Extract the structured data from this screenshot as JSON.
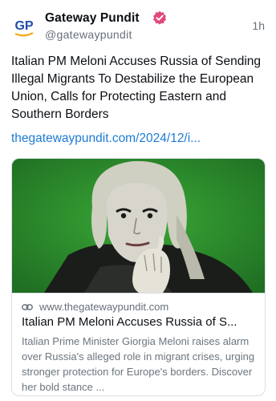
{
  "author": {
    "name": "Gateway Pundit",
    "handle": "@gatewaypundit",
    "avatar_text": "GP",
    "avatar_color": "#1f4fa8",
    "avatar_accent": "#f2a91a",
    "verified_color": "#e0497e"
  },
  "post": {
    "timestamp": "1h",
    "text": "Italian PM Meloni Accuses Russia of Sending Illegal Migrants To Destabilize the European Union, Calls for Protecting Eastern and Southern Borders",
    "link": "thegatewaypundit.com/2024/12/i..."
  },
  "card": {
    "domain": "www.thegatewaypundit.com",
    "title": "Italian PM Meloni Accuses Russia of S...",
    "description": "Italian Prime Minister Giorgia Meloni raises alarm over Russia's alleged role in migrant crises, urging stronger protection for Europe's borders. Discover her bold stance ...",
    "image_background": "#2e8f2c",
    "link_icon": "link-icon"
  }
}
